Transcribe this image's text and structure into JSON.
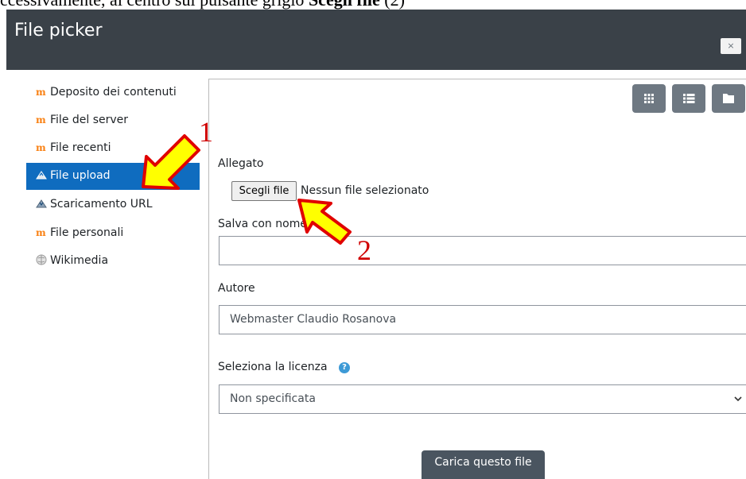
{
  "caption": {
    "text": "ccessivamente, al centro sul pulsante grigio ",
    "bold": "Scegli file",
    "suffix": " (2)"
  },
  "header": {
    "title": "File picker",
    "close_label": "×"
  },
  "sidebar": {
    "items": [
      {
        "label": "Deposito dei contenuti",
        "icon": "moodle-icon"
      },
      {
        "label": "File del server",
        "icon": "moodle-icon"
      },
      {
        "label": "File recenti",
        "icon": "moodle-icon"
      },
      {
        "label": "File upload",
        "icon": "upload-icon",
        "active": true
      },
      {
        "label": "Scaricamento URL",
        "icon": "download-icon"
      },
      {
        "label": "File personali",
        "icon": "moodle-icon"
      },
      {
        "label": "Wikimedia",
        "icon": "wikimedia-icon"
      }
    ]
  },
  "form": {
    "attachment_label": "Allegato",
    "choose_file_label": "Scegli file",
    "no_file_text": "Nessun file selezionato",
    "save_as_label": "Salva con nome",
    "save_as_value": "",
    "author_label": "Autore",
    "author_value": "Webmaster Claudio Rosanova",
    "license_label": "Seleziona la licenza",
    "license_value": "Non specificata",
    "upload_label": "Carica questo file"
  },
  "annotations": {
    "one": "1",
    "two": "2"
  },
  "colors": {
    "header_bg": "#3a4148",
    "active_bg": "#0f6cbf",
    "arrow_fill": "#ffff00",
    "arrow_stroke": "#e00000",
    "annotation": "#d00000"
  }
}
